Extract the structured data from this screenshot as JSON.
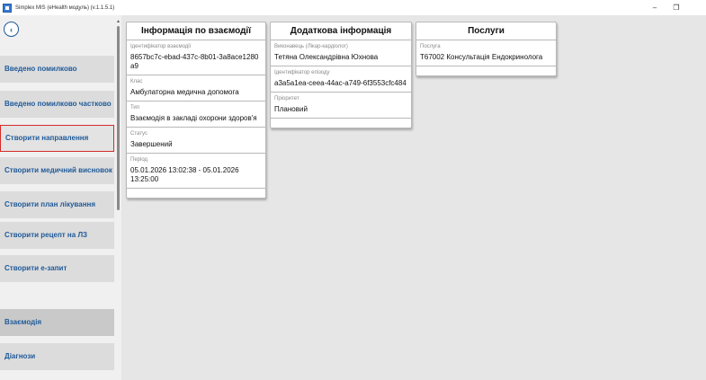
{
  "window": {
    "title": "Simplex MIS (eHealth модуль) (v.1.1.5.1)",
    "minimize_glyph": "–",
    "restore_glyph": "❐"
  },
  "sidebar": {
    "back_glyph": "‹",
    "items": [
      {
        "label": "Введено помилково"
      },
      {
        "label": "Введено помилково частково"
      },
      {
        "label": "Створити направлення"
      },
      {
        "label": "Створити медичний висновок"
      },
      {
        "label": "Створити план лікування"
      },
      {
        "label": "Створити рецепт на ЛЗ"
      },
      {
        "label": "Створити е-запит"
      },
      {
        "label": "Взаємодія"
      },
      {
        "label": "Діагнози"
      }
    ],
    "selected_item": "Створити направлення",
    "scroll_up_glyph": "▲"
  },
  "cards": {
    "interaction": {
      "title": "Інформація по взаємодії",
      "fields": [
        {
          "label": "Ідентифікатор взаємодії",
          "value": "8657bc7c-ebad-437c-8b01-3a8ace1280a9"
        },
        {
          "label": "Клас",
          "value": "Амбулаторна медична допомога"
        },
        {
          "label": "Тип",
          "value": "Взаємодія в закладі охорони здоров'я"
        },
        {
          "label": "Статус",
          "value": "Завершений"
        },
        {
          "label": "Період",
          "value": "05.01.2026 13:02:38 - 05.01.2026 13:25:00"
        }
      ]
    },
    "additional": {
      "title": "Додаткова інформація",
      "fields": [
        {
          "label": "Виконавець (Лікар-кардіолог)",
          "value": "Тетяна Олександрівна Юхнова"
        },
        {
          "label": "Ідентифікатор епізоду",
          "value": "a3a5a1ea-ceea-44ac-a749-6f3553cfc484"
        },
        {
          "label": "Пріоритет",
          "value": "Плановий"
        }
      ]
    },
    "services": {
      "title": "Послуги",
      "fields": [
        {
          "label": "Послуга",
          "value": "Т67002 Консультація Ендокринолога"
        }
      ]
    }
  },
  "colors": {
    "accent": "#1f5a99",
    "selected_border": "#d52b2b",
    "background": "#e6e6e6"
  }
}
